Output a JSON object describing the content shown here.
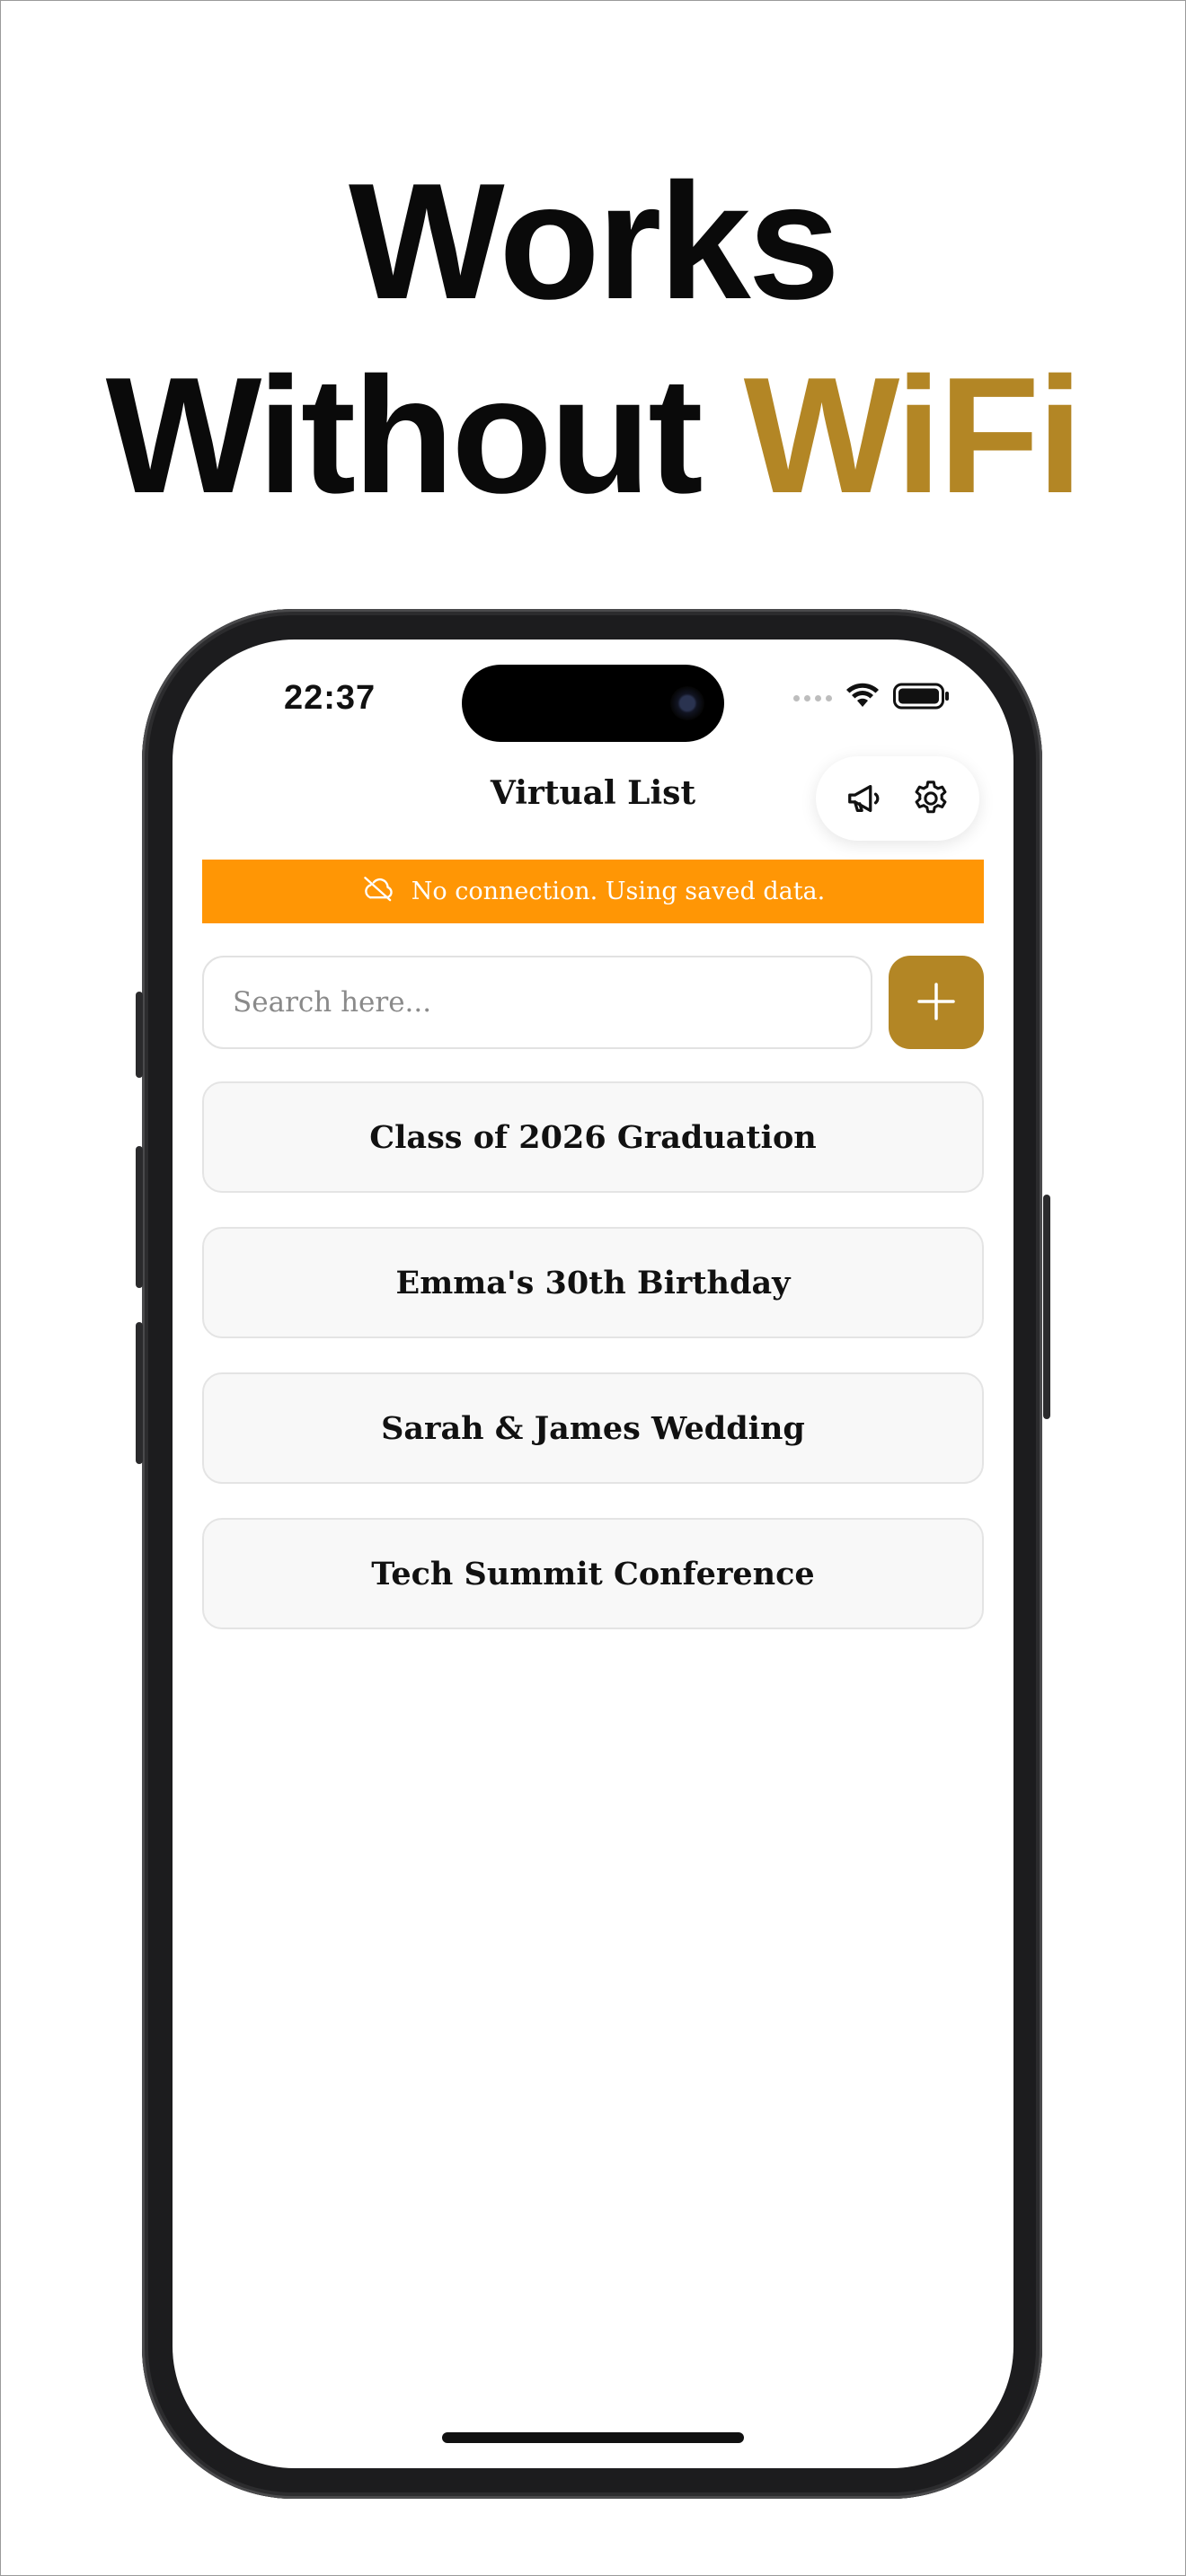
{
  "headline": {
    "line1": "Works",
    "line2_prefix": "Without ",
    "line2_accent": "WiFi"
  },
  "colors": {
    "accent": "#b38625",
    "banner": "#ff9605",
    "text": "#0a0a0a"
  },
  "status_bar": {
    "time": "22:37",
    "icons": [
      "signal-icon",
      "wifi-icon",
      "battery-icon"
    ]
  },
  "nav": {
    "title": "Virtual List",
    "actions": [
      {
        "icon": "megaphone-icon"
      },
      {
        "icon": "gear-icon"
      }
    ]
  },
  "banner": {
    "icon": "cloud-off-icon",
    "text": "No connection. Using saved data."
  },
  "search": {
    "placeholder": "Search here...",
    "value": ""
  },
  "add_button": {
    "icon": "plus-icon"
  },
  "lists": [
    {
      "title": "Class of 2026 Graduation"
    },
    {
      "title": "Emma's 30th Birthday"
    },
    {
      "title": "Sarah & James Wedding"
    },
    {
      "title": "Tech Summit Conference"
    }
  ]
}
